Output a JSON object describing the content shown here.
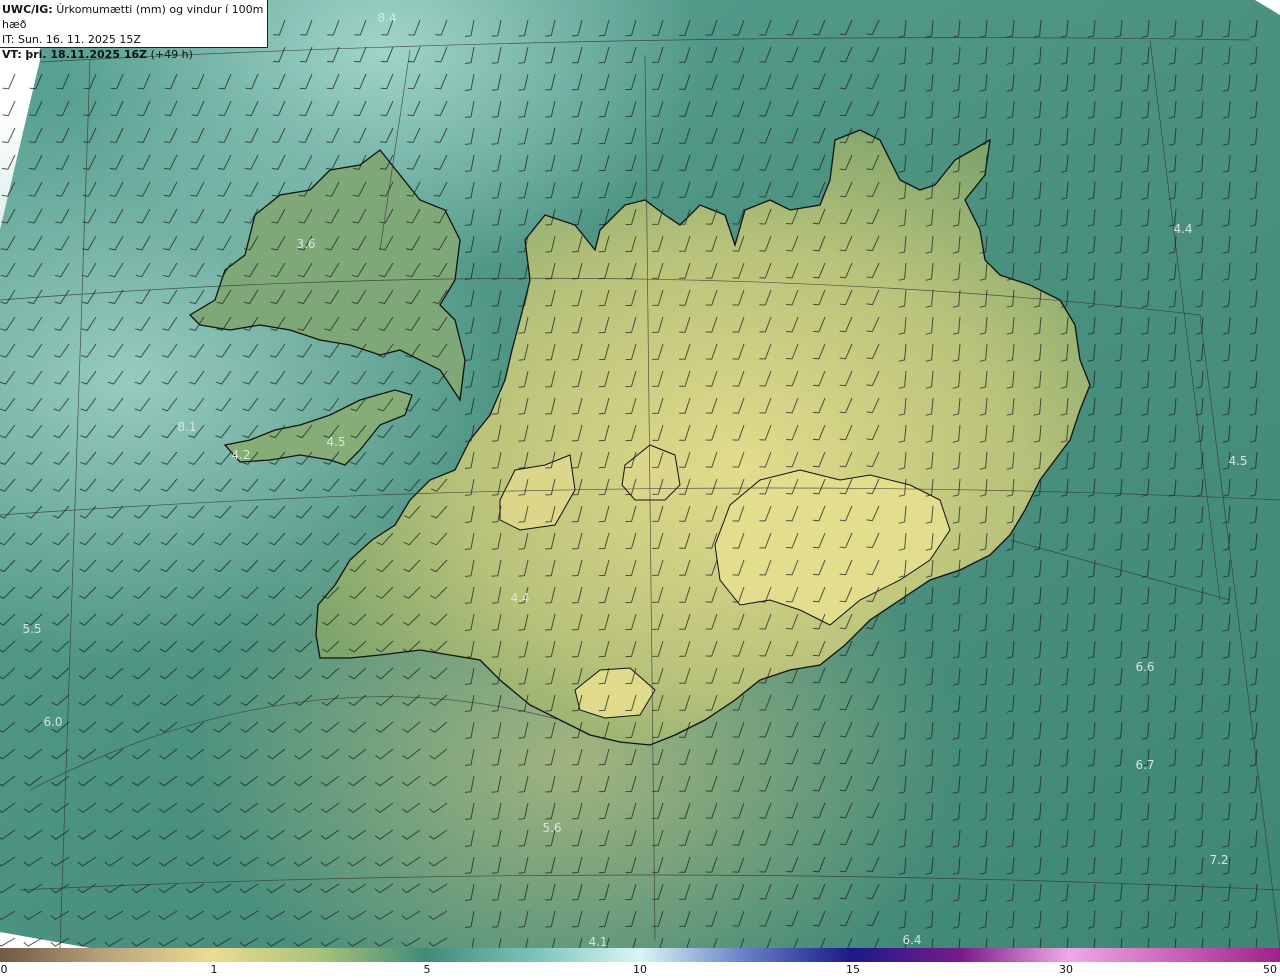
{
  "header": {
    "model": "UWC/IG:",
    "title": "Úrkomumætti (mm) og vindur í 100m hæð",
    "it_line": "IT: Sun. 16. 11. 2025 15Z",
    "vt_prefix": "VT:",
    "vt_main": "þri. 18.11.2025 16Z",
    "vt_offset": "(+49 h)"
  },
  "value_labels": [
    "8.4",
    "3.6",
    "4.4",
    "4.2",
    "8.1",
    "4.5",
    "4.4",
    "4.5",
    "5.5",
    "6.0",
    "6.6",
    "6.7",
    "5.6",
    "7.2",
    "4.1",
    "6.4"
  ],
  "colorbar": {
    "ticks": [
      "0",
      "1",
      "5",
      "10",
      "15",
      "30",
      "50"
    ]
  },
  "colors": {
    "ocean": "#3f8a78",
    "ocean_light": "#7fbcb0",
    "land_low": "#8cab6c",
    "land_high": "#dcd98a",
    "coastline": "#111111",
    "graticule": "#333333"
  }
}
